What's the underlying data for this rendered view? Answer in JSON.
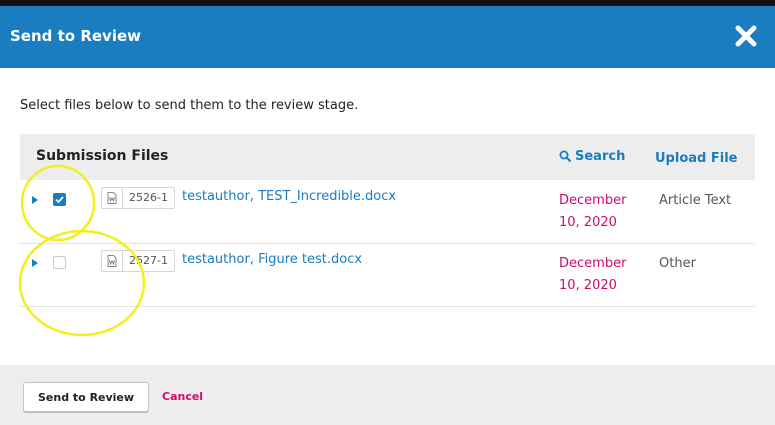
{
  "modal": {
    "title": "Send to Review",
    "close_icon": "close-icon",
    "intro": "Select files below to send them to the review stage."
  },
  "panel": {
    "title": "Submission Files",
    "search_label": "Search",
    "upload_label": "Upload File",
    "rows": [
      {
        "checked": true,
        "file_id": "2526-1",
        "file_name": "testauthor, TEST_Incredible.docx",
        "date": "December 10, 2020",
        "type": "Article Text"
      },
      {
        "checked": false,
        "file_id": "2527-1",
        "file_name": "testauthor, Figure test.docx",
        "date": "December 10, 2020",
        "type": "Other"
      }
    ]
  },
  "footer": {
    "send_label": "Send to Review",
    "cancel_label": "Cancel"
  },
  "colors": {
    "header": "#1a7dbf",
    "link": "#1a7dbf",
    "date": "#d00a6c",
    "cancel": "#d00a6c",
    "annotation": "#f2ef1f"
  }
}
